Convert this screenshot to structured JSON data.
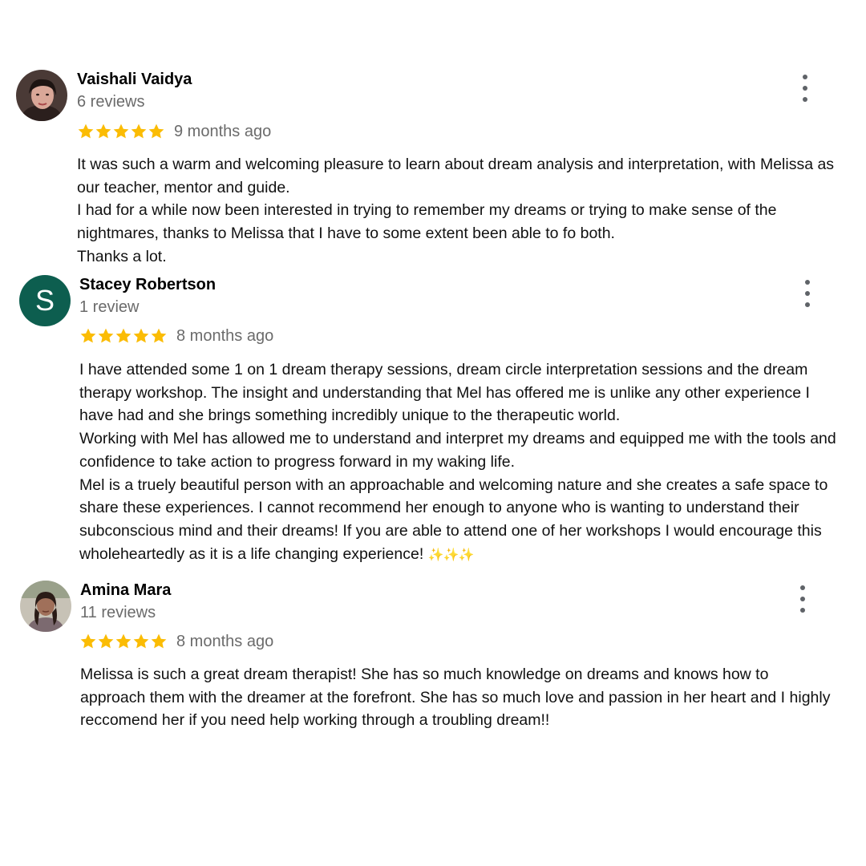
{
  "reviews": [
    {
      "author": "Vaishali Vaidya",
      "review_count": "6 reviews",
      "rating": 5,
      "date": "9 months ago",
      "paragraphs": [
        "It was such a warm and welcoming pleasure to learn about dream analysis and interpretation, with Melissa as our teacher, mentor and guide.",
        "I had for a while now been interested in trying to remember my dreams or trying to make sense of the nightmares, thanks to Melissa that I have to some extent been able to fo both.",
        "Thanks a lot."
      ]
    },
    {
      "author": "Stacey Robertson",
      "avatar_letter": "S",
      "avatar_color": "#0d5e4f",
      "review_count": "1 review",
      "rating": 5,
      "date": "8 months ago",
      "paragraphs": [
        "I have attended some 1 on 1 dream therapy sessions, dream circle interpretation sessions and the dream therapy workshop. The insight and understanding that Mel has offered me is unlike any other experience I have had and she brings something incredibly unique to the therapeutic world.",
        "Working with Mel has allowed me to understand and interpret my dreams and equipped me with the tools and confidence to take action to progress forward in my waking life.",
        "Mel is a truely beautiful person with an approachable and welcoming nature and she creates a safe space to share these experiences. I cannot recommend her enough to anyone who is wanting to understand their subconscious mind and their dreams! If you are able to attend one of her workshops I would encourage this wholeheartedly as it is a life changing experience!"
      ],
      "emoji": "✨✨✨"
    },
    {
      "author": "Amina Mara",
      "review_count": "11 reviews",
      "rating": 5,
      "date": "8 months ago",
      "paragraphs": [
        "Melissa is such a great dream therapist! She has so much knowledge on dreams and knows how to approach them with the dreamer at the forefront. She has so much love and passion in her heart and I highly reccomend her if you need help working through a troubling dream!!"
      ]
    }
  ],
  "colors": {
    "star": "#fbbc04",
    "secondary_text": "#6b6b6b",
    "menu_dots": "#5f6368"
  },
  "icons": {
    "star": "star-icon",
    "menu": "more-vert-icon"
  }
}
